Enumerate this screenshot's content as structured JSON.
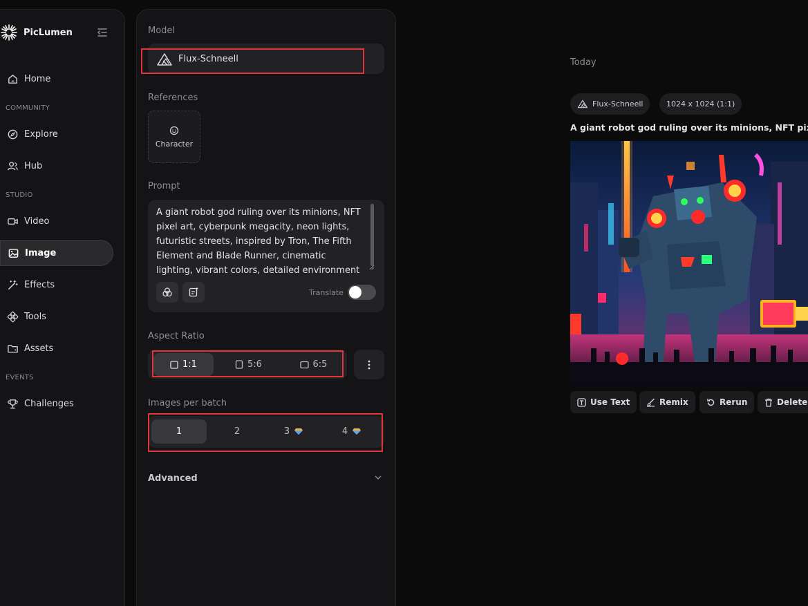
{
  "app": {
    "name": "PicLumen"
  },
  "sidebar": {
    "sections": {
      "community": "COMMUNITY",
      "studio": "STUDIO",
      "events": "EVENTS"
    },
    "items": [
      {
        "label": "Home",
        "icon": "home-icon"
      },
      {
        "label": "Explore",
        "icon": "compass-icon"
      },
      {
        "label": "Hub",
        "icon": "users-icon"
      },
      {
        "label": "Video",
        "icon": "video-icon"
      },
      {
        "label": "Image",
        "icon": "image-icon",
        "active": true
      },
      {
        "label": "Effects",
        "icon": "magic-wand-icon"
      },
      {
        "label": "Tools",
        "icon": "tools-icon"
      },
      {
        "label": "Assets",
        "icon": "folder-icon"
      },
      {
        "label": "Challenges",
        "icon": "trophy-icon"
      }
    ]
  },
  "panel": {
    "model_label": "Model",
    "model_name": "Flux-Schneell",
    "references_label": "References",
    "reference_card": "Character",
    "prompt_label": "Prompt",
    "prompt_text": "A giant robot god ruling over its minions, NFT pixel art, cyberpunk megacity, neon lights, futuristic streets, inspired by Tron, The Fifth Element and Blade Runner, cinematic lighting, vibrant colors, detailed environment",
    "translate_label": "Translate",
    "translate_on": false,
    "aspect_label": "Aspect Ratio",
    "aspect_options": [
      "1:1",
      "5:6",
      "6:5"
    ],
    "aspect_selected": "1:1",
    "batch_label": "Images per batch",
    "batch_options": [
      "1",
      "2",
      "3",
      "4"
    ],
    "batch_selected": "1",
    "advanced_label": "Advanced"
  },
  "main": {
    "date_group": "Today",
    "chips": {
      "model": "Flux-Schneell",
      "size": "1024 x 1024 (1:1)"
    },
    "image_title": "A giant robot god ruling over its minions, NFT pixel ar",
    "actions": [
      "Use Text",
      "Remix",
      "Rerun",
      "Delete"
    ]
  },
  "colors": {
    "highlight": "#e0353a",
    "panel": "#141416",
    "surface": "#222225",
    "accent_gem": "#f2b53a"
  }
}
